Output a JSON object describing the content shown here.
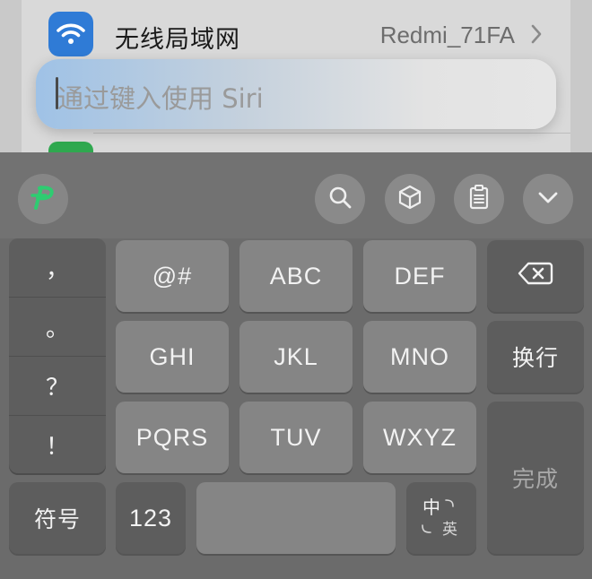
{
  "settings": {
    "wifi_label": "无线局域网",
    "wifi_value": "Redmi_71FA",
    "wifi_icon": "wifi-icon",
    "chevron_icon": "chevron-right-icon"
  },
  "siri": {
    "placeholder": "通过键入使用 Siri"
  },
  "keyboard": {
    "toolbar": {
      "logo_icon": "p-logo-icon",
      "tools": [
        "search-icon",
        "cube-icon",
        "clipboard-icon",
        "chevron-down-icon"
      ]
    },
    "punctuation": [
      "，",
      "。",
      "？",
      "！"
    ],
    "symbol_key": "符号",
    "keys": {
      "k1": "@#",
      "k2": "ABC",
      "k3": "DEF",
      "k4": "GHI",
      "k5": "JKL",
      "k6": "MNO",
      "k7": "PQRS",
      "k8": "TUV",
      "k9": "WXYZ"
    },
    "numbers_key": "123",
    "language_key": {
      "primary": "中",
      "secondary": "英"
    },
    "delete_icon": "backspace-icon",
    "newline_key": "换行",
    "done_key": "完成"
  },
  "colors": {
    "wifi_blue": "#2f7bd6",
    "logo_green": "#2ecc71",
    "keyboard_bg": "#6b6b6b"
  }
}
